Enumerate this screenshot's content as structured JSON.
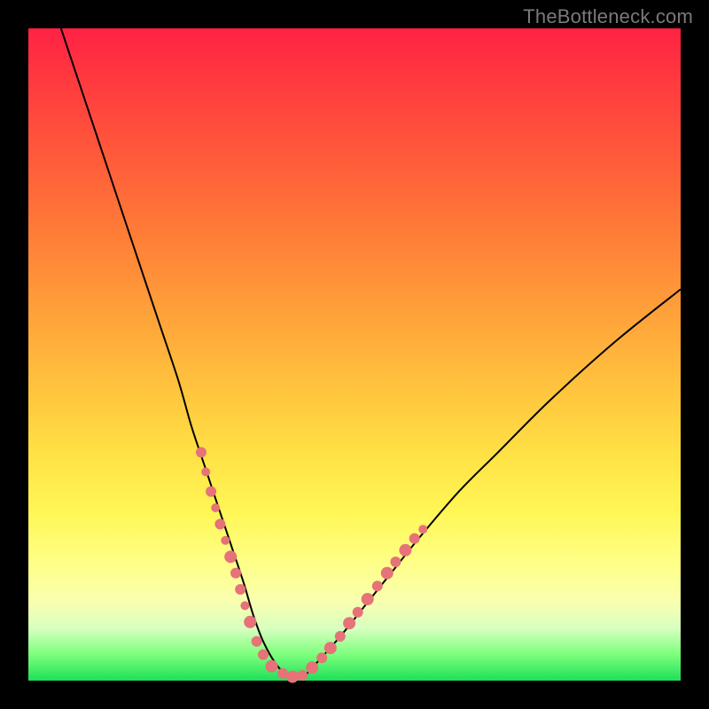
{
  "watermark": "TheBottleneck.com",
  "colors": {
    "background": "#000000",
    "curve": "#000000",
    "dots": "#e57377",
    "gradient_top": "#ff2244",
    "gradient_bottom": "#1fdf5a"
  },
  "chart_data": {
    "type": "line",
    "title": "",
    "xlabel": "",
    "ylabel": "",
    "xlim": [
      0,
      100
    ],
    "ylim": [
      0,
      100
    ],
    "grid": false,
    "series": [
      {
        "name": "bottleneck-curve",
        "x": [
          5,
          8,
          11,
          14,
          17,
          20,
          23,
          25,
          27,
          29,
          31,
          33,
          34.5,
          36,
          38,
          40,
          42,
          44,
          48,
          52,
          56,
          60,
          66,
          72,
          80,
          90,
          100
        ],
        "y": [
          100,
          91,
          82,
          73,
          64,
          55,
          46,
          39,
          33,
          27,
          21,
          15,
          10,
          6,
          2.5,
          0.6,
          0.6,
          2.5,
          7,
          12,
          17,
          22,
          29,
          35,
          43,
          52,
          60
        ]
      }
    ],
    "annotations": {
      "dots_note": "Salmon dots cluster along lower segments of the curve near the valley.",
      "dots": [
        {
          "x": 26.5,
          "y": 35,
          "r": 6
        },
        {
          "x": 27.2,
          "y": 32,
          "r": 5
        },
        {
          "x": 28.0,
          "y": 29,
          "r": 6
        },
        {
          "x": 28.7,
          "y": 26.5,
          "r": 5
        },
        {
          "x": 29.4,
          "y": 24,
          "r": 6
        },
        {
          "x": 30.2,
          "y": 21.5,
          "r": 5
        },
        {
          "x": 31.0,
          "y": 19,
          "r": 7
        },
        {
          "x": 31.8,
          "y": 16.5,
          "r": 6
        },
        {
          "x": 32.5,
          "y": 14,
          "r": 6
        },
        {
          "x": 33.2,
          "y": 11.5,
          "r": 5
        },
        {
          "x": 34.0,
          "y": 9,
          "r": 7
        },
        {
          "x": 35.0,
          "y": 6,
          "r": 6
        },
        {
          "x": 36.0,
          "y": 4,
          "r": 6
        },
        {
          "x": 37.3,
          "y": 2.2,
          "r": 7
        },
        {
          "x": 39.0,
          "y": 1.1,
          "r": 6
        },
        {
          "x": 40.5,
          "y": 0.6,
          "r": 7
        },
        {
          "x": 42.0,
          "y": 0.8,
          "r": 6
        },
        {
          "x": 43.5,
          "y": 2,
          "r": 7
        },
        {
          "x": 45.0,
          "y": 3.5,
          "r": 6
        },
        {
          "x": 46.3,
          "y": 5,
          "r": 7
        },
        {
          "x": 47.8,
          "y": 6.8,
          "r": 6
        },
        {
          "x": 49.2,
          "y": 8.8,
          "r": 7
        },
        {
          "x": 50.5,
          "y": 10.5,
          "r": 6
        },
        {
          "x": 52.0,
          "y": 12.5,
          "r": 7
        },
        {
          "x": 53.5,
          "y": 14.5,
          "r": 6
        },
        {
          "x": 55.0,
          "y": 16.5,
          "r": 7
        },
        {
          "x": 56.3,
          "y": 18.2,
          "r": 6
        },
        {
          "x": 57.8,
          "y": 20,
          "r": 7
        },
        {
          "x": 59.2,
          "y": 21.8,
          "r": 6
        },
        {
          "x": 60.5,
          "y": 23.2,
          "r": 5
        }
      ]
    }
  }
}
